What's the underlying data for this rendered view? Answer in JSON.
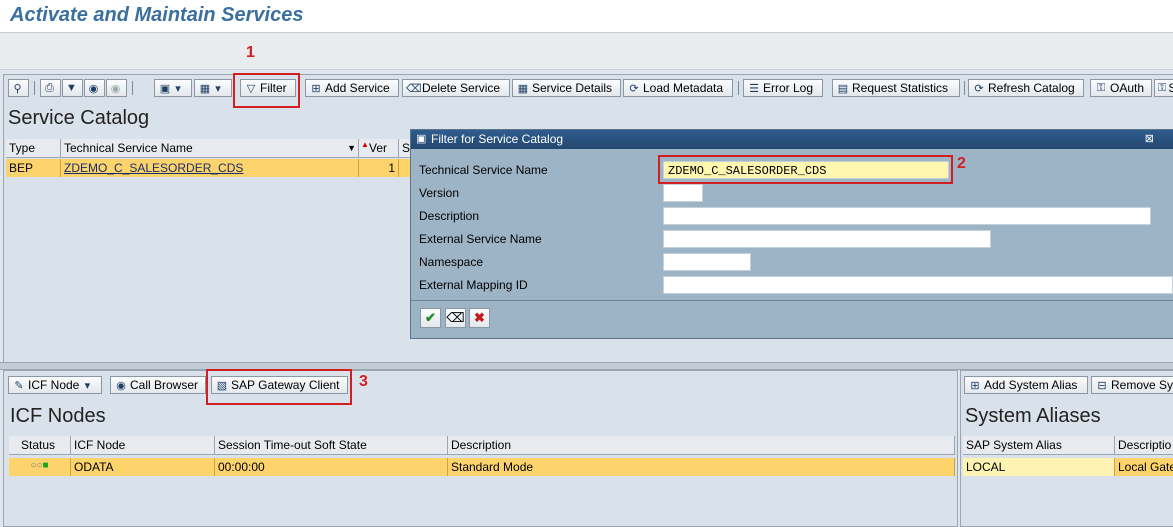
{
  "window": {
    "title": "Activate and Maintain Services"
  },
  "toolbar_top": {
    "filter": "Filter",
    "add_service": "Add Service",
    "delete_service": "Delete Service",
    "service_details": "Service Details",
    "load_metadata": "Load Metadata",
    "error_log": "Error Log",
    "request_statistics": "Request Statistics",
    "refresh_catalog": "Refresh Catalog",
    "oauth": "OAuth",
    "truncated": "S"
  },
  "service_catalog": {
    "title": "Service Catalog",
    "columns": [
      "Type",
      "Technical Service Name",
      "Ver",
      "S"
    ],
    "rows": [
      {
        "type": "BEP",
        "name": "ZDEMO_C_SALESORDER_CDS",
        "version": "1"
      }
    ]
  },
  "filter_dialog": {
    "title": "Filter for Service Catalog",
    "fields": [
      {
        "label": "Technical Service Name",
        "value": "ZDEMO_C_SALESORDER_CDS"
      },
      {
        "label": "Version",
        "value": ""
      },
      {
        "label": "Description",
        "value": ""
      },
      {
        "label": "External Service Name",
        "value": ""
      },
      {
        "label": "Namespace",
        "value": ""
      },
      {
        "label": "External Mapping ID",
        "value": ""
      }
    ]
  },
  "icf": {
    "toolbar": {
      "icf_node": "ICF Node",
      "call_browser": "Call Browser",
      "gateway_client": "SAP Gateway Client"
    },
    "title": "ICF Nodes",
    "columns": [
      "Status",
      "ICF Node",
      "Session Time-out Soft State",
      "Description"
    ],
    "rows": [
      {
        "node": "ODATA",
        "timeout": "00:00:00",
        "description": "Standard Mode"
      }
    ]
  },
  "aliases": {
    "toolbar": {
      "add": "Add System Alias",
      "remove": "Remove Sy"
    },
    "title": "System Aliases",
    "columns": [
      "SAP System Alias",
      "Descriptio"
    ],
    "rows": [
      {
        "alias": "LOCAL",
        "description": "Local Gate"
      }
    ]
  },
  "annotations": [
    "1",
    "2",
    "3"
  ],
  "colors": {
    "annotation": "#d21f1f",
    "selected_row": "#fcd46b",
    "dialog_bg": "#9db4c7",
    "title": "#3a6fa0"
  }
}
